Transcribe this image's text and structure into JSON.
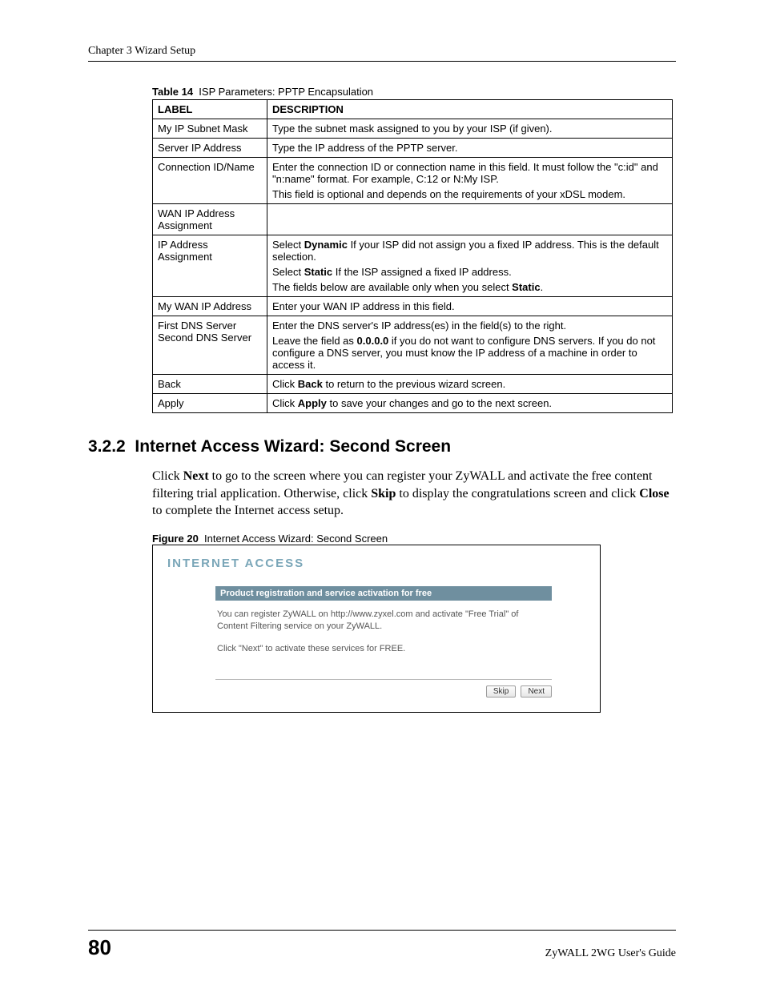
{
  "header": {
    "chapter": "Chapter 3 Wizard Setup"
  },
  "table": {
    "caption_label": "Table 14",
    "caption_text": "ISP Parameters: PPTP Encapsulation",
    "col_label": "LABEL",
    "col_desc": "DESCRIPTION",
    "rows": [
      {
        "label": "My IP Subnet Mask",
        "desc": "Type the subnet mask assigned to you by your ISP (if given)."
      },
      {
        "label": "Server IP Address",
        "desc": "Type the IP address of the PPTP server."
      },
      {
        "label": "Connection ID/Name",
        "desc_lines": [
          "Enter the connection ID or connection name in this field. It must follow the \"c:id\" and \"n:name\" format. For example, C:12 or N:My ISP.",
          "This field is optional and depends on the requirements of your xDSL modem."
        ]
      },
      {
        "label": "WAN IP Address Assignment",
        "desc": ""
      },
      {
        "label": "IP Address Assignment",
        "desc_html": "p1a p1b p2 p3",
        "p1_pre": "Select ",
        "p1_bold": "Dynamic",
        "p1_post": " If your ISP did not assign you a fixed IP address. This is the default selection.",
        "p2_pre": "Select ",
        "p2_bold": "Static",
        "p2_post": " If the ISP assigned a fixed IP address.",
        "p3_pre": "The fields below are available only when you select ",
        "p3_bold": "Static",
        "p3_post": "."
      },
      {
        "label": "My WAN IP Address",
        "desc": "Enter your WAN IP address in this field."
      },
      {
        "label_line1": "First DNS Server",
        "label_line2": "Second DNS Server",
        "p1": "Enter the DNS server's IP address(es) in the field(s) to the right.",
        "p2_pre": "Leave the field as ",
        "p2_bold": "0.0.0.0",
        "p2_post": " if you do not want to configure DNS servers. If you do not configure a DNS server, you must know the IP address of a machine in order to access it."
      },
      {
        "label": "Back",
        "d_pre": "Click ",
        "d_bold": "Back",
        "d_post": " to return to the previous wizard screen."
      },
      {
        "label": "Apply",
        "d_pre": "Click ",
        "d_bold": "Apply",
        "d_post": " to save your changes and go to the next screen."
      }
    ]
  },
  "section": {
    "number": "3.2.2",
    "title": "Internet Access Wizard: Second Screen",
    "p_pre": "Click ",
    "p_b1": "Next",
    "p_mid1": " to go to the screen where you can register your ZyWALL and activate the free content filtering trial application. Otherwise, click ",
    "p_b2": "Skip",
    "p_mid2": " to display the congratulations screen and click ",
    "p_b3": "Close",
    "p_post": " to complete the Internet access setup."
  },
  "figure": {
    "caption_label": "Figure 20",
    "caption_text": "Internet Access Wizard: Second Screen",
    "title": "INTERNET ACCESS",
    "bar": "Product registration and service activation for free",
    "line1": "You can register ZyWALL on http://www.zyxel.com and activate \"Free Trial\" of Content Filtering service on your ZyWALL.",
    "line2": "Click \"Next\" to activate these services for FREE.",
    "btn_skip": "Skip",
    "btn_next": "Next"
  },
  "footer": {
    "page": "80",
    "guide": "ZyWALL 2WG User's Guide"
  }
}
